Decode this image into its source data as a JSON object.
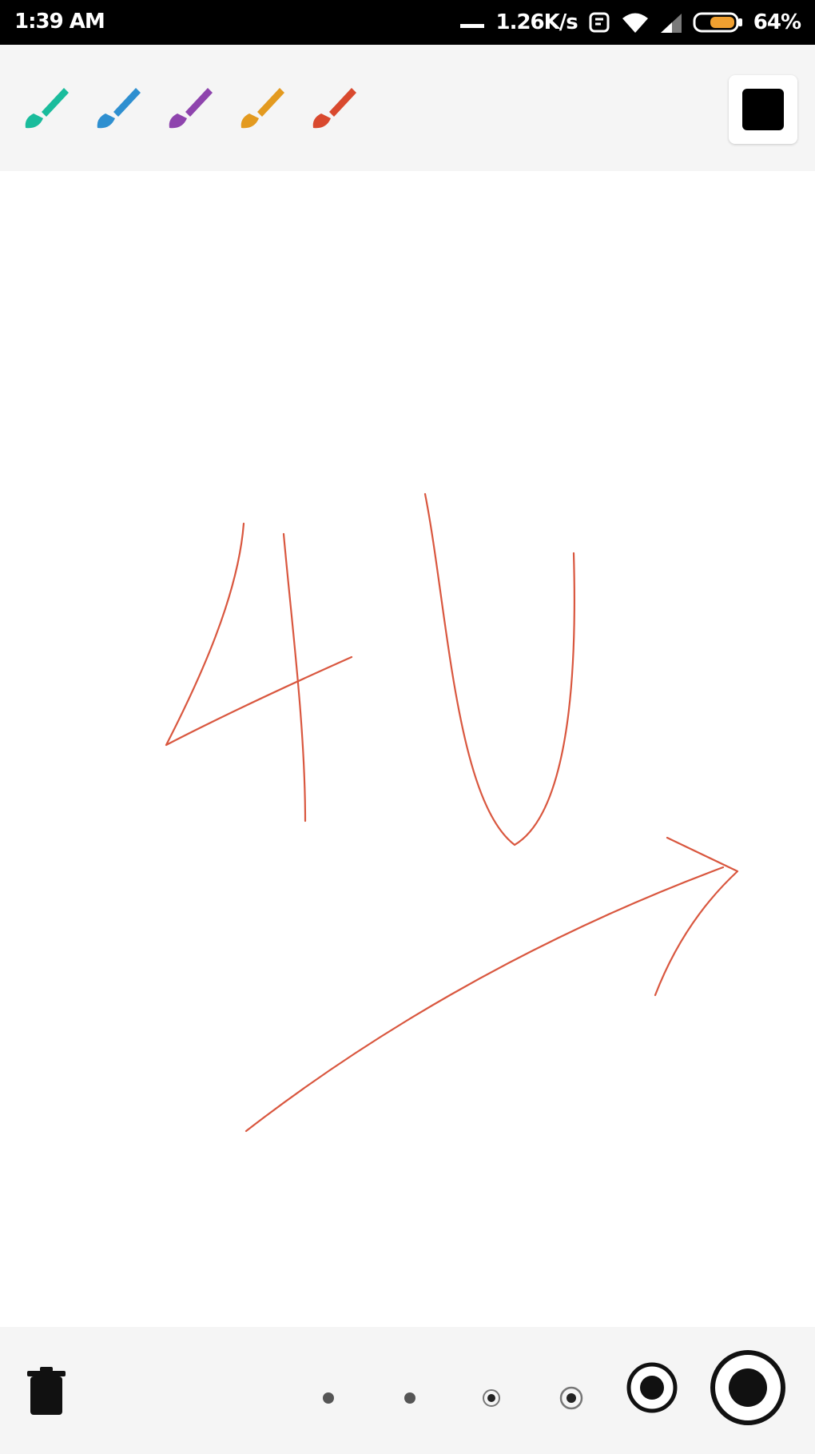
{
  "status_bar": {
    "time": "1:39 AM",
    "speed": "1.26K/s",
    "battery": "64%",
    "icons": [
      "notification-dash-icon",
      "alarm-icon",
      "wifi-icon",
      "signal-icon",
      "battery-icon"
    ]
  },
  "toolbar": {
    "brushes": [
      {
        "name": "brush-teal",
        "color": "#1abc9c"
      },
      {
        "name": "brush-blue",
        "color": "#2e8fd0"
      },
      {
        "name": "brush-purple",
        "color": "#8e44ad"
      },
      {
        "name": "brush-orange",
        "color": "#e39a1f"
      },
      {
        "name": "brush-red",
        "color": "#d9492e"
      }
    ],
    "selected_color": "#000000"
  },
  "canvas": {
    "stroke_color": "#d9573f"
  },
  "bottom_bar": {
    "icons": [
      "trash-icon"
    ],
    "stroke_sizes": [
      "size-1",
      "size-2",
      "size-3",
      "size-4",
      "size-5",
      "size-6"
    ],
    "selected_size": "size-6"
  }
}
